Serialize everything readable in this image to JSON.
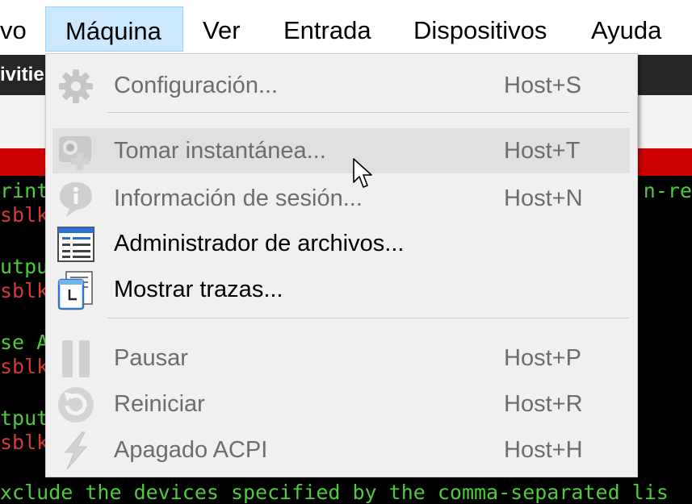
{
  "menubar": {
    "items": [
      {
        "label": "vo"
      },
      {
        "label": "Máquina"
      },
      {
        "label": "Ver"
      },
      {
        "label": "Entrada"
      },
      {
        "label": "Dispositivos"
      },
      {
        "label": "Ayuda"
      }
    ]
  },
  "guest": {
    "title_fragment": "ivitie",
    "terminal": {
      "lines": [
        {
          "text": "rint",
          "color": "green"
        },
        {
          "text": "sblk",
          "color": "red"
        },
        {
          "text": "utput",
          "color": "green"
        },
        {
          "text": "sblk",
          "color": "red"
        },
        {
          "text": "se As",
          "color": "green"
        },
        {
          "text": "sblk",
          "color": "red"
        },
        {
          "text": "tput",
          "color": "green"
        },
        {
          "text": "sblk",
          "color": "red"
        },
        {
          "text": "xclude the devices specified by the comma-separated lis",
          "color": "green"
        }
      ],
      "right_fragment": "n-re"
    }
  },
  "menu": {
    "items": [
      {
        "label": "Configuración...",
        "shortcut": "Host+S",
        "icon": "gear-icon",
        "enabled": false
      },
      {
        "label": "Tomar instantánea...",
        "shortcut": "Host+T",
        "icon": "camera-snapshot-icon",
        "enabled": false
      },
      {
        "label": "Información de sesión...",
        "shortcut": "Host+N",
        "icon": "info-bubble-icon",
        "enabled": false
      },
      {
        "label": "Administrador de archivos...",
        "shortcut": "",
        "icon": "file-manager-icon",
        "enabled": true
      },
      {
        "label": "Mostrar trazas...",
        "shortcut": "",
        "icon": "log-viewer-icon",
        "enabled": true
      },
      {
        "label": "Pausar",
        "shortcut": "Host+P",
        "icon": "pause-icon",
        "enabled": false
      },
      {
        "label": "Reiniciar",
        "shortcut": "Host+R",
        "icon": "reset-icon",
        "enabled": false
      },
      {
        "label": "Apagado ACPI",
        "shortcut": "Host+H",
        "icon": "acpi-shutdown-icon",
        "enabled": false
      }
    ]
  },
  "colors": {
    "menu_bg": "#f0f0f0",
    "active_menubar_bg": "#cce8ff",
    "hover_row_bg": "#e0e0e0",
    "disabled_text": "#6d6d6d",
    "terminal_green": "#4ecb3b",
    "terminal_red": "#d23a3a",
    "accent_red_bar": "#cc0000"
  }
}
